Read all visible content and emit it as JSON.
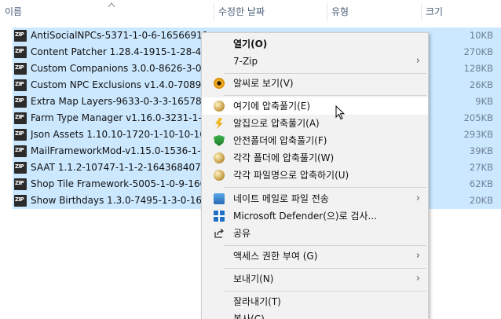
{
  "columns": {
    "name": "이름",
    "modified": "수정한 날짜",
    "type": "유형",
    "size": "크기"
  },
  "files": [
    {
      "name": "AntiSocialNPCs-5371-1-0-6-16566911...",
      "size": "10KB"
    },
    {
      "name": "Content Patcher 1.28.4-1915-1-28-4-1...",
      "size": "270KB"
    },
    {
      "name": "Custom Companions 3.0.0-8626-3-0-0...",
      "size": "128KB"
    },
    {
      "name": "Custom NPC Exclusions v1.4.0-7089-1-...",
      "size": "26KB"
    },
    {
      "name": "Extra Map Layers-9633-0-3-3-1657841...",
      "size": "9KB"
    },
    {
      "name": "Farm Type Manager v1.16.0-3231-1-16...",
      "size": "205KB"
    },
    {
      "name": "Json Assets 1.10.10-1720-1-10-10-166...",
      "size": "293KB"
    },
    {
      "name": "MailFrameworkMod-v1.15.0-1536-1-15...",
      "size": "39KB"
    },
    {
      "name": "SAAT 1.1.2-10747-1-1-2-1643684073",
      "size": "27KB"
    },
    {
      "name": "Shop Tile Framework-5005-1-0-9-1608...",
      "size": "62KB"
    },
    {
      "name": "Show Birthdays 1.3.0-7495-1-3-0-1652...",
      "size": "20KB"
    }
  ],
  "menu": {
    "open": "열기(O)",
    "sevenzip": "7-Zip",
    "view_alzip": "알씨로 보기(V)",
    "extract_here": "여기에 압축풀기(E)",
    "extract_alzip": "알집으로 압축풀기(A)",
    "extract_safe": "안전폴더에 압축풀기(F)",
    "extract_each": "각각 폴더에 압축풀기(W)",
    "compress_each": "각각 파일명으로 압축하기(U)",
    "send_naver": "네이트 메일로 파일 전송",
    "defender": "Microsoft Defender(으)로 검사...",
    "share": "공유",
    "access": "액세스 권한 부여 (G)",
    "send_to": "보내기(N)",
    "cut": "잘라내기(T)",
    "copy": "복사(C)"
  },
  "icons": {
    "alzip": "alzip-ball-icon",
    "alsee": "alsee-eye-icon",
    "lightning": "alzip-lightning-icon",
    "shield": "safe-folder-shield-icon",
    "mail": "nate-mail-icon",
    "defender": "defender-icon",
    "share": "share-icon",
    "chevron": "›"
  }
}
